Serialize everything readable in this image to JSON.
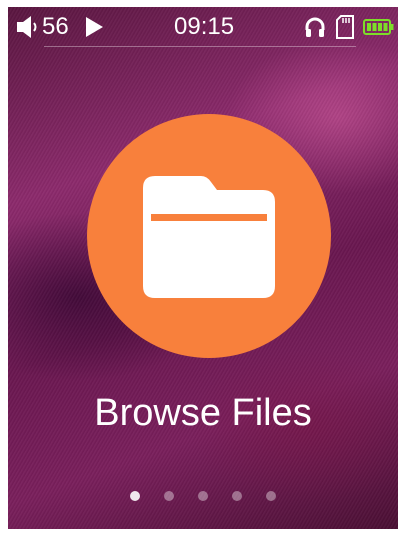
{
  "status_bar": {
    "volume_icon": "speaker-icon",
    "volume_level": "56",
    "play_icon": "play-icon",
    "time": "09:15",
    "headphone_icon": "headphones-icon",
    "sd_card_icon": "sd-card-icon",
    "battery_icon": "battery-icon",
    "battery_color": "#7dde28"
  },
  "main": {
    "icon": "folder-icon",
    "icon_background": "#f8803c",
    "label": "Browse Files"
  },
  "pagination": {
    "page_count": 5,
    "active_page": 1
  }
}
